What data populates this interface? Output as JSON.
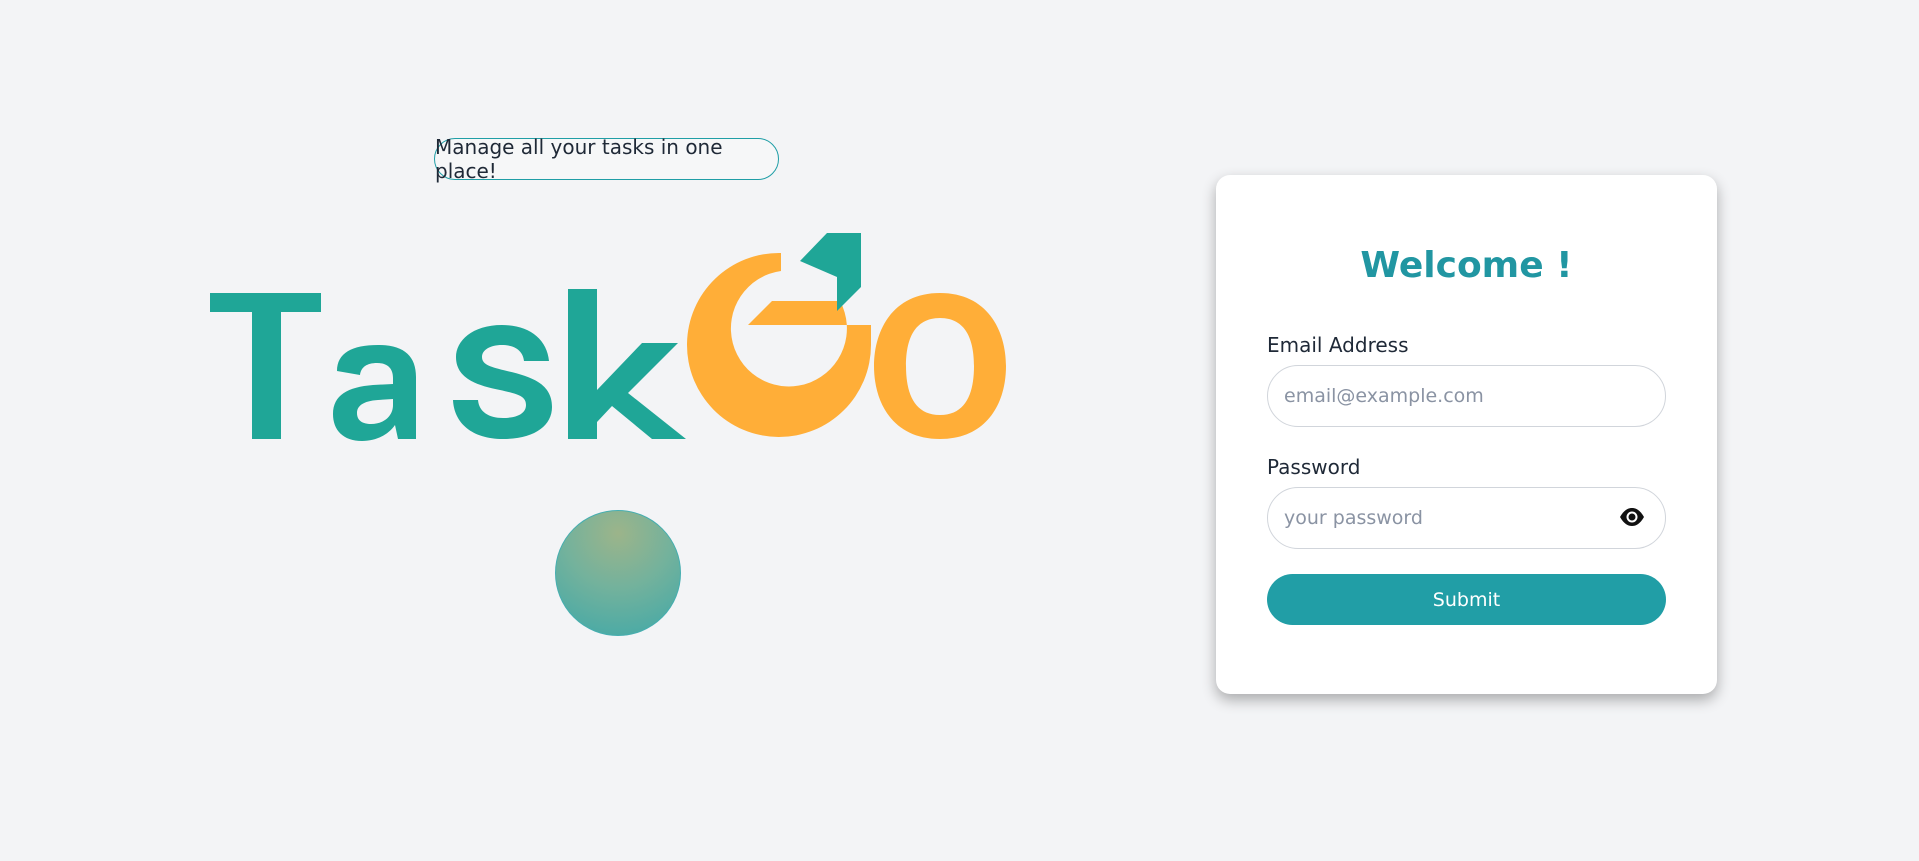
{
  "hero": {
    "tagline": "Manage all your tasks in one place!",
    "logo_text_task": "Task",
    "logo_text_go": "GO",
    "colors": {
      "teal": "#1fa697",
      "orange": "#ffae38"
    }
  },
  "login": {
    "title": "Welcome !",
    "email_label": "Email Address",
    "email_placeholder": "email@example.com",
    "password_label": "Password",
    "password_placeholder": "your password",
    "password_toggle_icon": "eye-icon",
    "submit_label": "Submit",
    "accent": "#219ea6"
  }
}
